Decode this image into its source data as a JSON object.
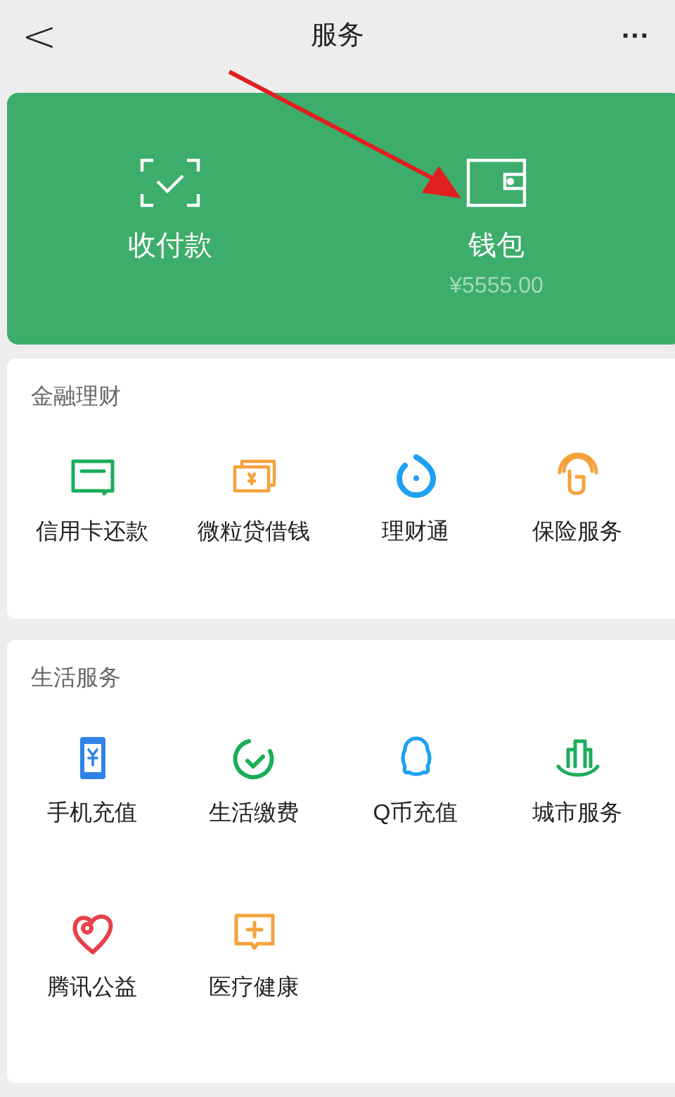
{
  "header": {
    "back": "<",
    "title": "服务",
    "more": "···"
  },
  "top_card": [
    {
      "label": "收付款"
    },
    {
      "label": "钱包",
      "amount": "¥5555.00"
    }
  ],
  "sections": [
    {
      "title": "金融理财",
      "items": [
        {
          "label": "信用卡还款"
        },
        {
          "label": "微粒贷借钱"
        },
        {
          "label": "理财通"
        },
        {
          "label": "保险服务"
        }
      ]
    },
    {
      "title": "生活服务",
      "items": [
        {
          "label": "手机充值"
        },
        {
          "label": "生活缴费"
        },
        {
          "label": "Q币充值"
        },
        {
          "label": "城市服务"
        },
        {
          "label": "腾讯公益"
        },
        {
          "label": "医疗健康"
        }
      ]
    }
  ]
}
